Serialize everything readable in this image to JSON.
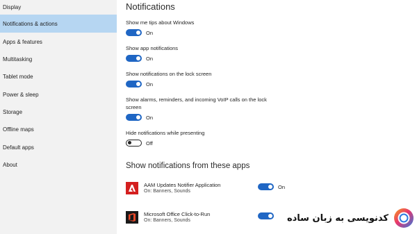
{
  "sidebar": {
    "items": [
      {
        "label": "Display",
        "active": false
      },
      {
        "label": "Notifications & actions",
        "active": true
      },
      {
        "label": "Apps & features",
        "active": false
      },
      {
        "label": "Multitasking",
        "active": false
      },
      {
        "label": "Tablet mode",
        "active": false
      },
      {
        "label": "Power & sleep",
        "active": false
      },
      {
        "label": "Storage",
        "active": false
      },
      {
        "label": "Offline maps",
        "active": false
      },
      {
        "label": "Default apps",
        "active": false
      },
      {
        "label": "About",
        "active": false
      }
    ]
  },
  "main": {
    "title": "Notifications",
    "settings": [
      {
        "label": "Show me tips about Windows",
        "state": "On"
      },
      {
        "label": "Show app notifications",
        "state": "On"
      },
      {
        "label": "Show notifications on the lock screen",
        "state": "On"
      },
      {
        "label": "Show alarms, reminders, and incoming VoIP calls on the lock screen",
        "state": "On"
      },
      {
        "label": "Hide notifications while presenting",
        "state": "Off"
      }
    ],
    "apps_section_title": "Show notifications from these apps",
    "apps": [
      {
        "name": "AAM Updates Notifier Application",
        "detail": "On: Banners, Sounds",
        "state": "On",
        "icon": "adobe-icon"
      },
      {
        "name": "Microsoft Office Click-to-Run",
        "detail": "On: Banners, Sounds",
        "state": "On",
        "icon": "office-icon"
      }
    ]
  },
  "watermark": {
    "text": "کدنویسی به زبان ساده"
  },
  "colors": {
    "sidebar_bg": "#f2f2f2",
    "active_item_bg": "#b6d6f2",
    "toggle_on": "#1f66c4",
    "adobe_red": "#d41f1f"
  }
}
